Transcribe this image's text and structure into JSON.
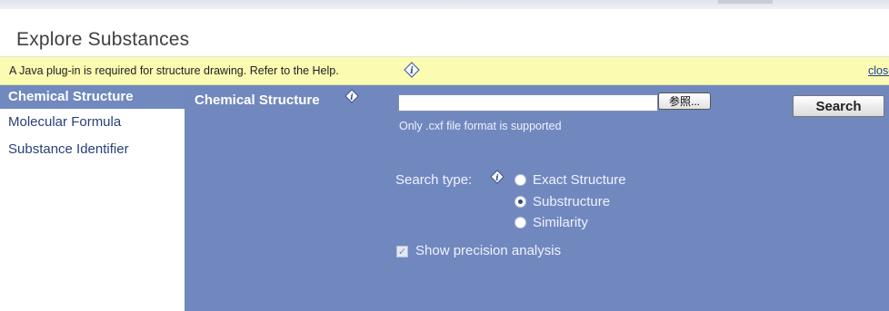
{
  "header": {
    "title": "Explore Substances"
  },
  "notice": {
    "message": "A Java plug-in is required for structure drawing. Refer to the Help.",
    "close_label": "close"
  },
  "sidebar": {
    "items": [
      {
        "label": "Chemical Structure",
        "active": true
      },
      {
        "label": "Molecular Formula",
        "active": false
      },
      {
        "label": "Substance Identifier",
        "active": false
      }
    ]
  },
  "panel": {
    "title": "Chemical Structure",
    "file_input": {
      "value": ""
    },
    "browse_label": "参照...",
    "hint": "Only .cxf file format is supported",
    "search_label": "Search",
    "search_type_label": "Search type:",
    "search_types": [
      {
        "label": "Exact Structure",
        "checked": false
      },
      {
        "label": "Substructure",
        "checked": true
      },
      {
        "label": "Similarity",
        "checked": false
      }
    ],
    "precision_label": "Show precision analysis",
    "precision_checked": true
  },
  "icons": {
    "info": "info-diamond-icon"
  },
  "colors": {
    "panel_bg": "#7188bf",
    "notice_bg": "#fbfbb2",
    "link": "#1b3c9e"
  }
}
